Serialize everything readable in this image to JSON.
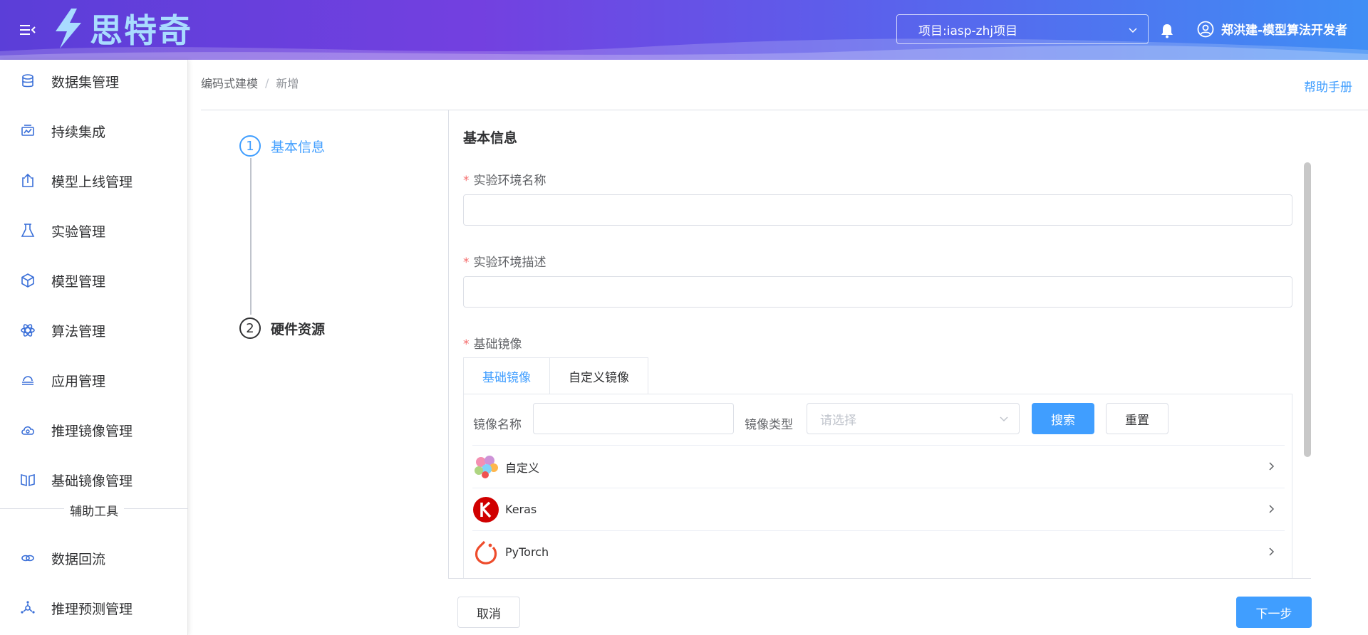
{
  "header": {
    "logo_text": "思特奇",
    "project_label": "项目:iasp-zhj项目",
    "user_name": "郑洪建-模型算法开发者",
    "colors": {
      "gradient_start": "#5b3ed8",
      "gradient_end": "#3f8ef5",
      "logo_text": "#a9dcff"
    }
  },
  "sidebar": {
    "items": [
      {
        "label": "数据集管理",
        "icon": "database-icon"
      },
      {
        "label": "持续集成",
        "icon": "integration-icon"
      },
      {
        "label": "模型上线管理",
        "icon": "upload-icon"
      },
      {
        "label": "实验管理",
        "icon": "flask-icon"
      },
      {
        "label": "模型管理",
        "icon": "cube-icon"
      },
      {
        "label": "算法管理",
        "icon": "atom-icon"
      },
      {
        "label": "应用管理",
        "icon": "cloud-stack-icon"
      },
      {
        "label": "推理镜像管理",
        "icon": "cloud-mirror-icon"
      },
      {
        "label": "基础镜像管理",
        "icon": "book-icon"
      }
    ],
    "section_title": "辅助工具",
    "tool_items": [
      {
        "label": "数据回流",
        "icon": "link-icon"
      },
      {
        "label": "推理预测管理",
        "icon": "network-icon"
      }
    ]
  },
  "breadcrumb": {
    "parent": "编码式建模",
    "separator": "/",
    "current": "新增"
  },
  "help_link": "帮助手册",
  "steps": [
    {
      "number": "1",
      "title": "基本信息",
      "state": "active"
    },
    {
      "number": "2",
      "title": "硬件资源",
      "state": "next"
    }
  ],
  "form": {
    "title": "基本信息",
    "required_mark": "*",
    "env_name_label": "实验环境名称",
    "env_name_value": "",
    "env_desc_label": "实验环境描述",
    "env_desc_value": "",
    "base_image_label": "基础镜像",
    "tabs": [
      {
        "label": "基础镜像",
        "active": true
      },
      {
        "label": "自定义镜像",
        "active": false
      }
    ],
    "filter": {
      "name_label": "镜像名称",
      "name_value": "",
      "type_label": "镜像类型",
      "type_placeholder": "请选择",
      "search_button": "搜索",
      "reset_button": "重置"
    },
    "images": [
      {
        "name": "自定义",
        "icon": "custom-image-icon"
      },
      {
        "name": "Keras",
        "icon": "keras-icon"
      },
      {
        "name": "PyTorch",
        "icon": "pytorch-icon"
      }
    ]
  },
  "footer": {
    "cancel_button": "取消",
    "next_button": "下一步"
  },
  "accent_color": "#409eff"
}
